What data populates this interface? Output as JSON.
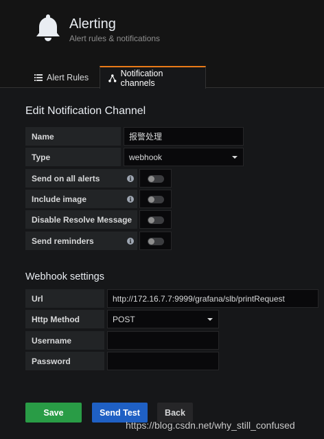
{
  "header": {
    "title": "Alerting",
    "subtitle": "Alert rules & notifications",
    "icon": "bell-icon"
  },
  "tabs": [
    {
      "label": "Alert Rules",
      "icon": "list-icon",
      "active": false
    },
    {
      "label": "Notification channels",
      "icon": "share-nodes-icon",
      "active": true
    }
  ],
  "edit_section": {
    "title": "Edit Notification Channel",
    "name": {
      "label": "Name",
      "value": "报警处理"
    },
    "type": {
      "label": "Type",
      "value": "webhook"
    },
    "toggles": [
      {
        "label": "Send on all alerts",
        "info": true,
        "on": false
      },
      {
        "label": "Include image",
        "info": true,
        "on": false
      },
      {
        "label": "Disable Resolve Message",
        "info": false,
        "on": false
      },
      {
        "label": "Send reminders",
        "info": true,
        "on": false
      }
    ]
  },
  "webhook_section": {
    "title": "Webhook settings",
    "url": {
      "label": "Url",
      "value": "http://172.16.7.7:9999/grafana/slb/printRequest"
    },
    "http_method": {
      "label": "Http Method",
      "value": "POST"
    },
    "username": {
      "label": "Username",
      "value": ""
    },
    "password": {
      "label": "Password",
      "value": ""
    }
  },
  "buttons": {
    "save": "Save",
    "send_test": "Send Test",
    "back": "Back"
  },
  "watermark": "https://blog.csdn.net/why_still_confused",
  "colors": {
    "accent_tab": "#eb7b18",
    "save": "#299c46",
    "send_test": "#1f60c4"
  }
}
